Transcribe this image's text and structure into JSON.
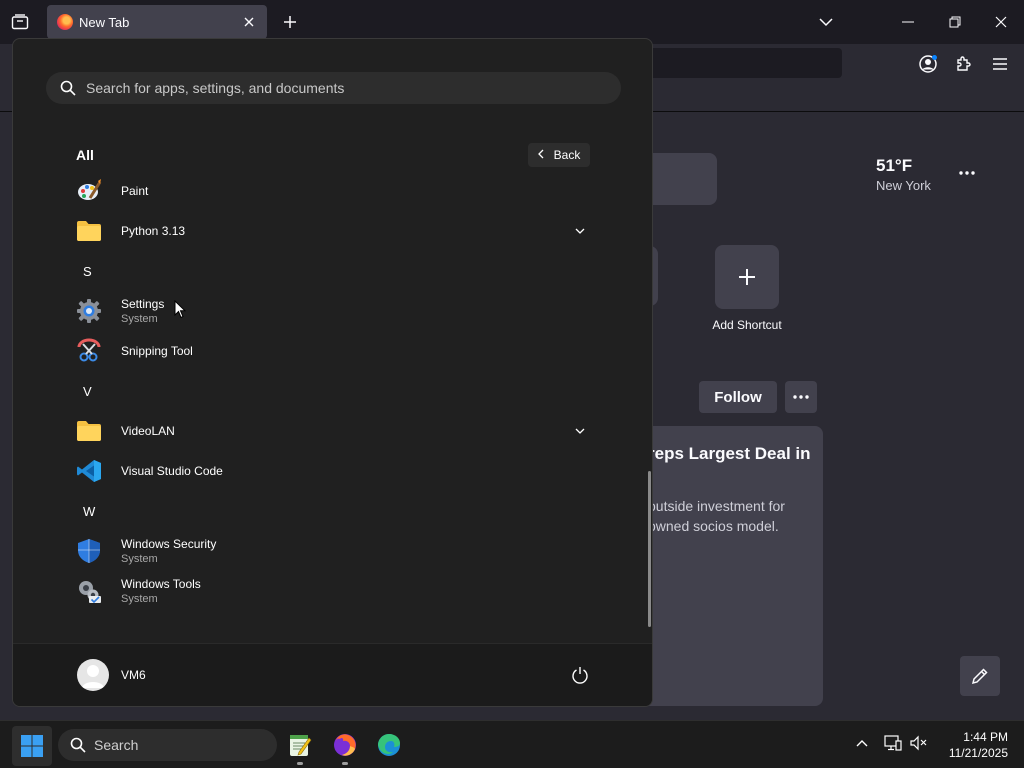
{
  "browser": {
    "tab_title": "New Tab"
  },
  "new_tab_page": {
    "weather_temp": "51°F",
    "weather_city": "New York",
    "add_shortcut_label": "Add Shortcut",
    "follow_label": "Follow",
    "story_headline": "reps Largest Deal in",
    "story_excerpt": "outside investment for\nowned socios model."
  },
  "start_menu": {
    "search_placeholder": "Search for apps, settings, and documents",
    "all_label": "All",
    "back_label": "Back",
    "items": [
      {
        "type": "app",
        "name": "Paint",
        "icon": "paint-icon"
      },
      {
        "type": "folder",
        "name": "Python 3.13",
        "icon": "folder-icon",
        "expandable": true
      },
      {
        "type": "letter",
        "name": "S"
      },
      {
        "type": "app",
        "name": "Settings",
        "subtitle": "System",
        "icon": "settings-gear-icon"
      },
      {
        "type": "app",
        "name": "Snipping Tool",
        "icon": "snipping-tool-icon"
      },
      {
        "type": "letter",
        "name": "V"
      },
      {
        "type": "folder",
        "name": "VideoLAN",
        "icon": "folder-icon",
        "expandable": true
      },
      {
        "type": "app",
        "name": "Visual Studio Code",
        "icon": "vscode-icon"
      },
      {
        "type": "letter",
        "name": "W"
      },
      {
        "type": "app",
        "name": "Windows Security",
        "subtitle": "System",
        "icon": "windows-security-shield-icon"
      },
      {
        "type": "app",
        "name": "Windows Tools",
        "subtitle": "System",
        "icon": "windows-tools-icon"
      }
    ],
    "user_name": "VM6"
  },
  "taskbar": {
    "search_label": "Search",
    "time": "1:44 PM",
    "date": "11/21/2025"
  },
  "colors": {
    "start_bg": "#202020",
    "browser_bg": "#2b2a33",
    "card_bg": "#42414d",
    "windows_blue": "#0a84ff"
  }
}
